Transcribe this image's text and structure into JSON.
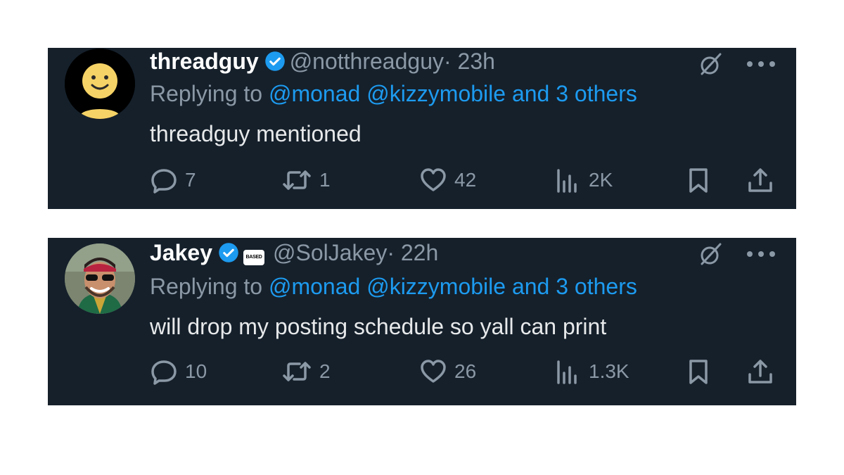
{
  "tweets": [
    {
      "display_name": "threadguy",
      "handle": "@notthreadguy",
      "time": "· 23h",
      "replying_label": "Replying to",
      "replying_mentions": "@monad @kizzymobile and 3 others",
      "text": "threadguy mentioned",
      "stats": {
        "replies": "7",
        "reposts": "1",
        "likes": "42",
        "views": "2K"
      },
      "avatar_icon": "smiley-face-icon"
    },
    {
      "display_name": "Jakey",
      "handle": "@SolJakey",
      "time": "· 22h",
      "affiliation_badge": "BASED",
      "replying_label": "Replying to",
      "replying_mentions": "@monad @kizzymobile and 3 others",
      "text": "will drop my posting schedule so yall can print",
      "stats": {
        "replies": "10",
        "reposts": "2",
        "likes": "26",
        "views": "1.3K"
      },
      "avatar_icon": "profile-photo"
    }
  ],
  "colors": {
    "card_background": "#15202b",
    "link_blue": "#1d9bf0",
    "muted_gray": "#8b98a5",
    "text": "#e7e9ea",
    "page_background": "#ffffff"
  }
}
